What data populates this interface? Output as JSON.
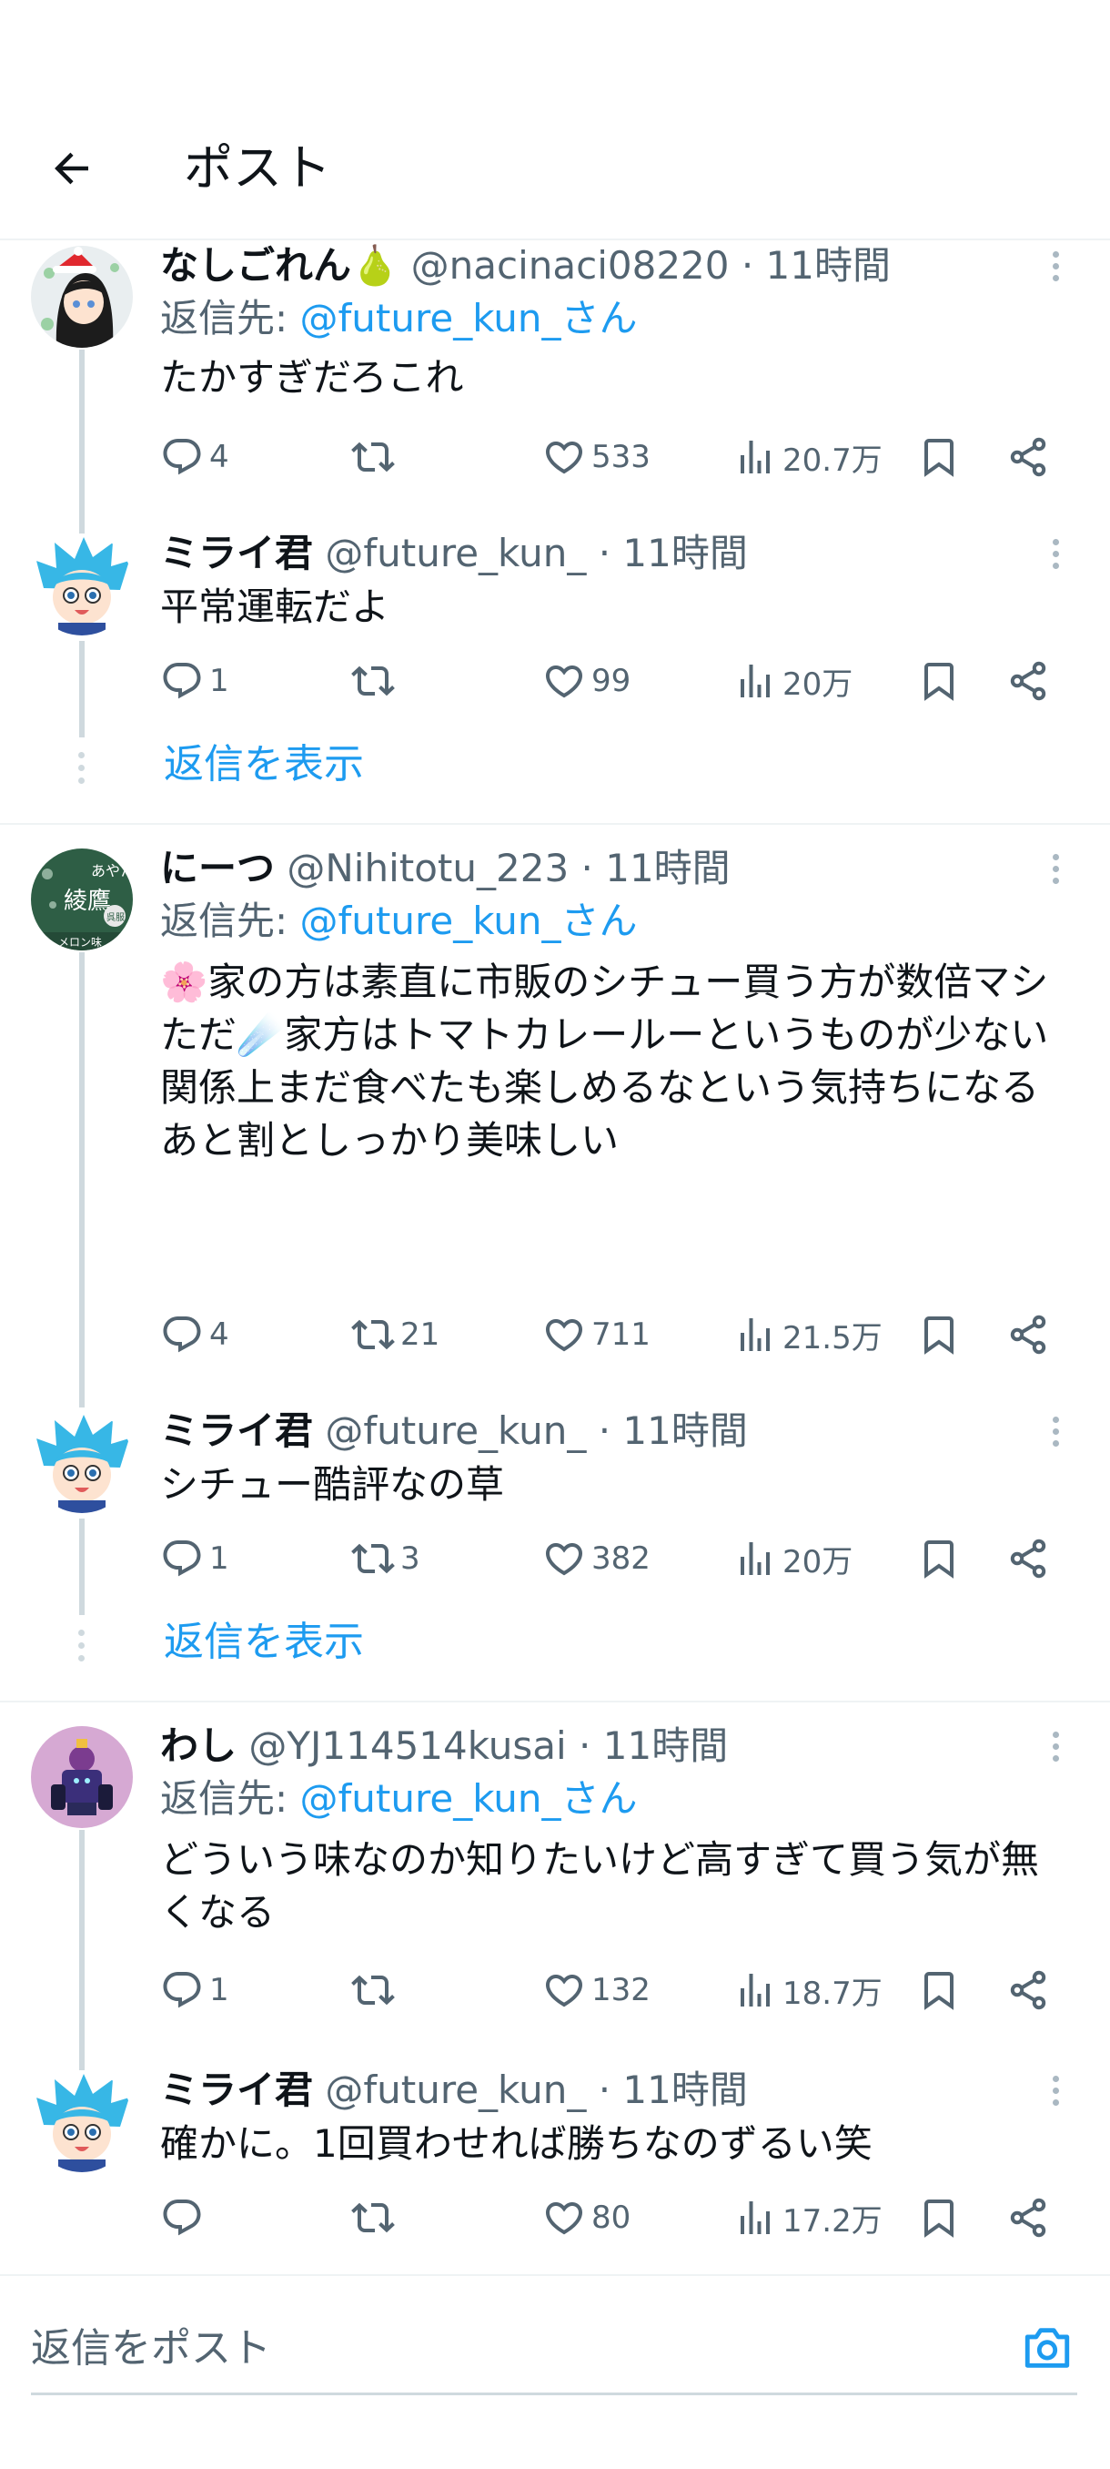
{
  "header": {
    "title": "ポスト",
    "back_icon": "arrow-left-icon"
  },
  "tweets": [
    {
      "name": "なしごれん🍐",
      "handle": "@nacinaci08220",
      "time": "· 11時間",
      "reply_to_prefix": "返信先: ",
      "reply_to": "@future_kun_さん",
      "text": "たかすぎだろこれ",
      "stats": {
        "replies": "4",
        "retweets": "",
        "likes": "533",
        "views": "20.7万"
      }
    },
    {
      "name": "ミライ君",
      "handle": "@future_kun_",
      "time": "· 11時間",
      "text": "平常運転だよ",
      "stats": {
        "replies": "1",
        "retweets": "",
        "likes": "99",
        "views": "20万"
      },
      "show_replies": "返信を表示"
    },
    {
      "name": "にーつ",
      "handle": "@Nihitotu_223",
      "time": "· 11時間",
      "reply_to_prefix": "返信先: ",
      "reply_to": "@future_kun_さん",
      "text": "🌸家の方は素直に市販のシチュー買う方が数倍マシ\nただ☄️家方はトマトカレールーというものが少ない関係上まだ食べたも楽しめるなという気持ちになる\nあと割としっかり美味しい",
      "stats": {
        "replies": "4",
        "retweets": "21",
        "likes": "711",
        "views": "21.5万"
      }
    },
    {
      "name": "ミライ君",
      "handle": "@future_kun_",
      "time": "· 11時間",
      "text": "シチュー酷評なの草",
      "stats": {
        "replies": "1",
        "retweets": "3",
        "likes": "382",
        "views": "20万"
      },
      "show_replies": "返信を表示"
    },
    {
      "name": "わし",
      "handle": "@YJ114514kusai",
      "time": "· 11時間",
      "reply_to_prefix": "返信先: ",
      "reply_to": "@future_kun_さん",
      "text": "どういう味なのか知りたいけど高すぎて買う気が無くなる",
      "stats": {
        "replies": "1",
        "retweets": "",
        "likes": "132",
        "views": "18.7万"
      }
    },
    {
      "name": "ミライ君",
      "handle": "@future_kun_",
      "time": "· 11時間",
      "text": "確かに。1回買わせれば勝ちなのずるい笑",
      "stats": {
        "replies": "",
        "retweets": "",
        "likes": "80",
        "views": "17.2万"
      }
    }
  ],
  "avatar_texts": {
    "nihitotu_line1": "あやたか",
    "nihitotu_line2": "綾鷹",
    "nihitotu_badge": "呉服",
    "nihitotu_bottom": "メロン味"
  },
  "composer": {
    "placeholder": "返信をポスト",
    "camera_icon": "camera-icon"
  },
  "colors": {
    "link": "#1d9bf0",
    "secondary": "#536471",
    "text": "#0f1419",
    "line": "#cfd9de"
  }
}
